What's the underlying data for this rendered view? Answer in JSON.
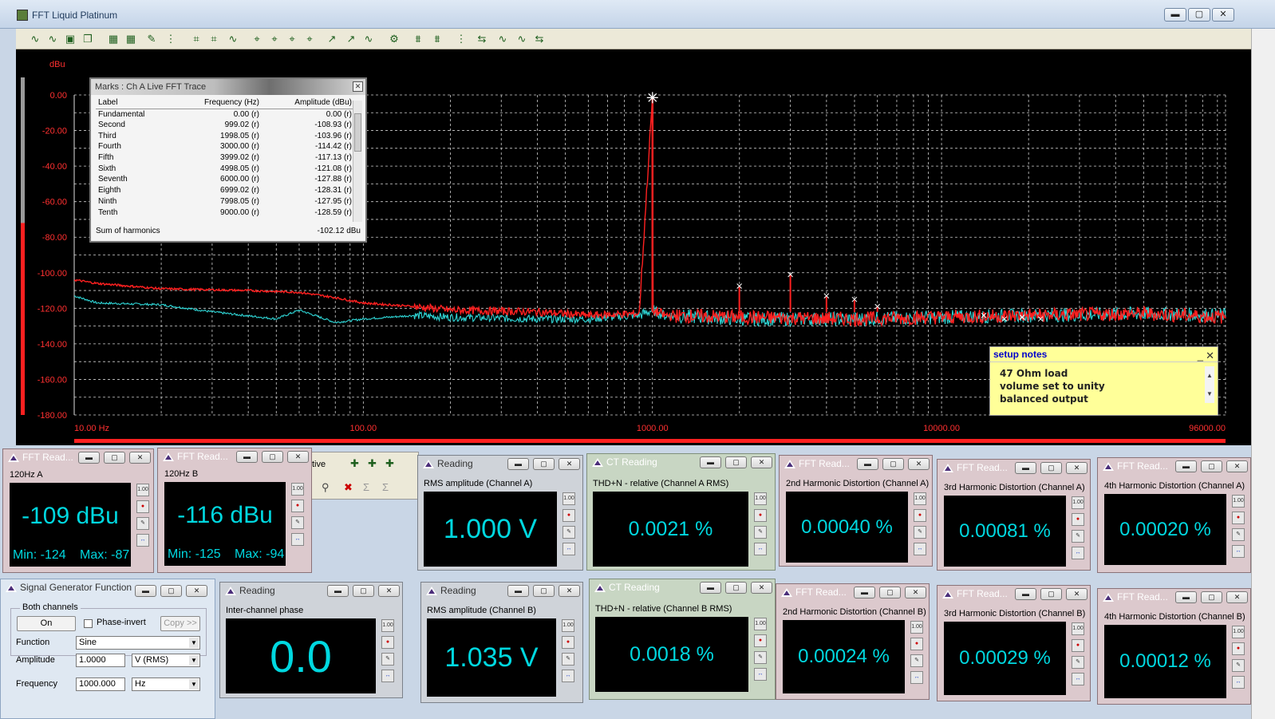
{
  "window": {
    "title": "FFT Liquid Platinum",
    "min": "▬",
    "max": "▢",
    "close": "✕"
  },
  "toolbar_icons": [
    "trace-icon",
    "trace-icon",
    "save-icon",
    "copy-icon",
    "chart-icon",
    "chart-icon",
    "edit-icon",
    "grid-icon",
    "zoom-icon",
    "zoom-icon",
    "trace-icon",
    "marker-icon",
    "marker-icon",
    "marker-icon",
    "marker-icon",
    "cursor-icon",
    "cursor-icon",
    "trace-icon",
    "settings-icon",
    "filter-icon",
    "filter-icon",
    "grid-icon",
    "arrows-icon",
    "trace-icon",
    "trace-icon",
    "arrows-icon"
  ],
  "chart_data": {
    "type": "line",
    "ylabel": "dBu",
    "yticks": [
      "0.00",
      "-20.00",
      "-40.00",
      "-60.00",
      "-80.00",
      "-100.00",
      "-120.00",
      "-140.00",
      "-160.00",
      "-180.00"
    ],
    "xticks": [
      "10.00 Hz",
      "100.00",
      "1000.00",
      "10000.00",
      "96000.00"
    ],
    "xlim": [
      10,
      96000
    ],
    "ylim": [
      -180,
      0
    ],
    "x_scale": "log",
    "grid": true,
    "series": [
      {
        "color": "#ff2020",
        "x": [
          10,
          12,
          20,
          40,
          60,
          80,
          100,
          150,
          200,
          400,
          600,
          900,
          1000,
          1001,
          1100,
          2000,
          5000,
          10000,
          20000,
          50000,
          96000
        ],
        "y": [
          -104,
          -106,
          -109,
          -110,
          -111,
          -114,
          -117,
          -119,
          -121,
          -122,
          -124,
          -123,
          -1,
          -121,
          -124,
          -125,
          -126,
          -125,
          -124,
          -123,
          -125
        ]
      },
      {
        "color": "#2fd6d6",
        "x": [
          10,
          12,
          20,
          30,
          50,
          60,
          80,
          100,
          150,
          200,
          400,
          600,
          900,
          1000,
          1100,
          2000,
          5000,
          10000,
          20000,
          50000,
          96000
        ],
        "y": [
          -113,
          -117,
          -118,
          -122,
          -126,
          -121,
          -128,
          -126,
          -124,
          -125,
          -126,
          -126,
          -124,
          -121,
          -124,
          -126,
          -126,
          -125,
          -124,
          -123,
          -124
        ]
      }
    ],
    "harmonic_markers": [
      {
        "freq": 1000.5,
        "level": -1.5,
        "fundamental": true
      },
      {
        "freq": 1998.05,
        "level": -107.5
      },
      {
        "freq": 3000.0,
        "level": -101
      },
      {
        "freq": 3999.02,
        "level": -113
      },
      {
        "freq": 4998.05,
        "level": -115
      },
      {
        "freq": 6000.0,
        "level": -119
      },
      {
        "freq": 14000,
        "level": -124
      },
      {
        "freq": 16500,
        "level": -126
      },
      {
        "freq": 19000,
        "level": -125
      },
      {
        "freq": 22000,
        "level": -126
      }
    ]
  },
  "marks": {
    "title": "Marks : Ch A Live FFT Trace",
    "headers": [
      "Label",
      "Frequency (Hz)",
      "Amplitude (dBu)"
    ],
    "rows": [
      [
        "Fundamental",
        "0.00 (r)",
        "0.00 (r)"
      ],
      [
        "Second",
        "999.02 (r)",
        "-108.93 (r)"
      ],
      [
        "Third",
        "1998.05 (r)",
        "-103.96 (r)"
      ],
      [
        "Fourth",
        "3000.00 (r)",
        "-114.42 (r)"
      ],
      [
        "Fifth",
        "3999.02 (r)",
        "-117.13 (r)"
      ],
      [
        "Sixth",
        "4998.05 (r)",
        "-121.08 (r)"
      ],
      [
        "Seventh",
        "6000.00 (r)",
        "-127.88 (r)"
      ],
      [
        "Eighth",
        "6999.02 (r)",
        "-128.31 (r)"
      ],
      [
        "Ninth",
        "7998.05 (r)",
        "-127.95 (r)"
      ],
      [
        "Tenth",
        "9000.00 (r)",
        "-128.59 (r)"
      ]
    ],
    "sum_label": "Sum of harmonics",
    "sum_value": "-102.12 dBu"
  },
  "notes": {
    "title": "setup notes",
    "lines": [
      "47 Ohm load",
      "volume set to unity",
      "balanced output"
    ]
  },
  "partial_toolbar": {
    "text": "tive"
  },
  "meters": {
    "fft1": {
      "title": "FFT Read...",
      "label": "120Hz A",
      "value": "-109 dBu",
      "min": "Min: -124",
      "max": "Max: -87"
    },
    "fft2": {
      "title": "FFT Read...",
      "label": "120Hz B",
      "value": "-116 dBu",
      "min": "Min: -125",
      "max": "Max: -94"
    },
    "r1": {
      "title": "Reading",
      "label": "RMS amplitude (Channel A)",
      "value": "1.000 V"
    },
    "ct1": {
      "title": "CT Reading",
      "label": "THD+N - relative (Channel A RMS)",
      "value": "0.0021 %"
    },
    "h2a": {
      "title": "FFT Read...",
      "label": "2nd Harmonic Distortion (Channel A)",
      "value": "0.00040 %"
    },
    "h3a": {
      "title": "FFT Read...",
      "label": "3rd Harmonic Distortion (Channel A)",
      "value": "0.00081 %"
    },
    "h4a": {
      "title": "FFT Read...",
      "label": "4th Harmonic Distortion (Channel A)",
      "value": "0.00020 %"
    },
    "ph": {
      "title": "Reading",
      "label": "Inter-channel phase",
      "value": "0.0"
    },
    "r2": {
      "title": "Reading",
      "label": "RMS amplitude (Channel B)",
      "value": "1.035 V"
    },
    "ct2": {
      "title": "CT Reading",
      "label": "THD+N - relative (Channel B RMS)",
      "value": "0.0018 %"
    },
    "h2b": {
      "title": "FFT Read...",
      "label": "2nd Harmonic Distortion (Channel B)",
      "value": "0.00024 %"
    },
    "h3b": {
      "title": "FFT Read...",
      "label": "3rd Harmonic Distortion (Channel B)",
      "value": "0.00029 %"
    },
    "h4b": {
      "title": "FFT Read...",
      "label": "4th Harmonic Distortion (Channel B)",
      "value": "0.00012 %"
    }
  },
  "meter_side": {
    "scale": "1.00"
  },
  "siggen": {
    "title": "Signal Generator Function",
    "group": "Both channels",
    "on_label": "On",
    "phase_invert": "Phase-invert",
    "copy": "Copy >>",
    "function_label": "Function",
    "function_value": "Sine",
    "amplitude_label": "Amplitude",
    "amplitude_value": "1.0000",
    "amplitude_unit": "V (RMS)",
    "frequency_label": "Frequency",
    "frequency_value": "1000.000",
    "frequency_unit": "Hz"
  }
}
